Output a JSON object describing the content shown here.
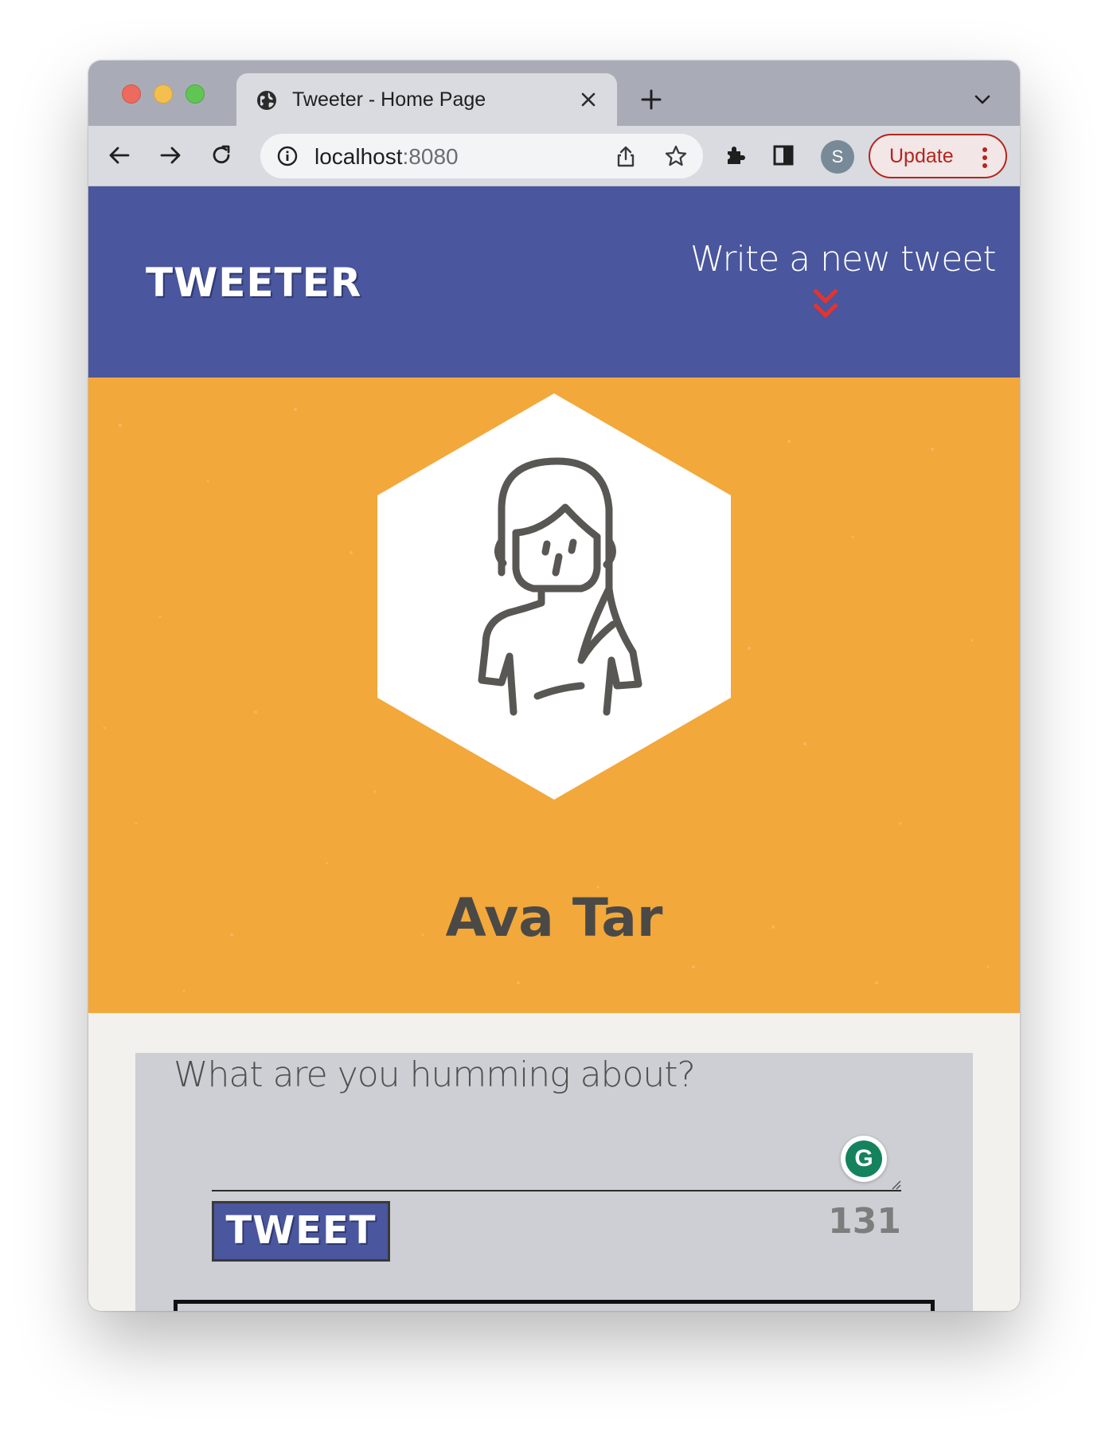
{
  "browser": {
    "tab_title": "Tweeter - Home Page",
    "url_host": "localhost",
    "url_port": ":8080",
    "profile_initial": "S",
    "update_label": "Update"
  },
  "nav": {
    "brand": "TWEETER",
    "compose_link": "Write a new tweet"
  },
  "profile": {
    "name": "Ava Tar"
  },
  "composer": {
    "placeholder": "What are you humming about?",
    "tweet_button": "TWEET",
    "char_counter": "131",
    "grammarly_letter": "G"
  },
  "colors": {
    "nav_bg": "#4a569d",
    "profile_bg": "#f2a83b",
    "chevron": "#e3342f",
    "page_bg": "#f2f1ed"
  },
  "icons": {
    "tab": "globe-icon",
    "back": "back-arrow-icon",
    "forward": "forward-arrow-icon",
    "reload": "reload-icon",
    "site_info": "info-icon",
    "share": "share-icon",
    "bookmark": "star-icon",
    "extensions": "puzzle-icon",
    "side_panel": "side-panel-icon",
    "compose_indicator": "double-chevron-down-icon"
  }
}
